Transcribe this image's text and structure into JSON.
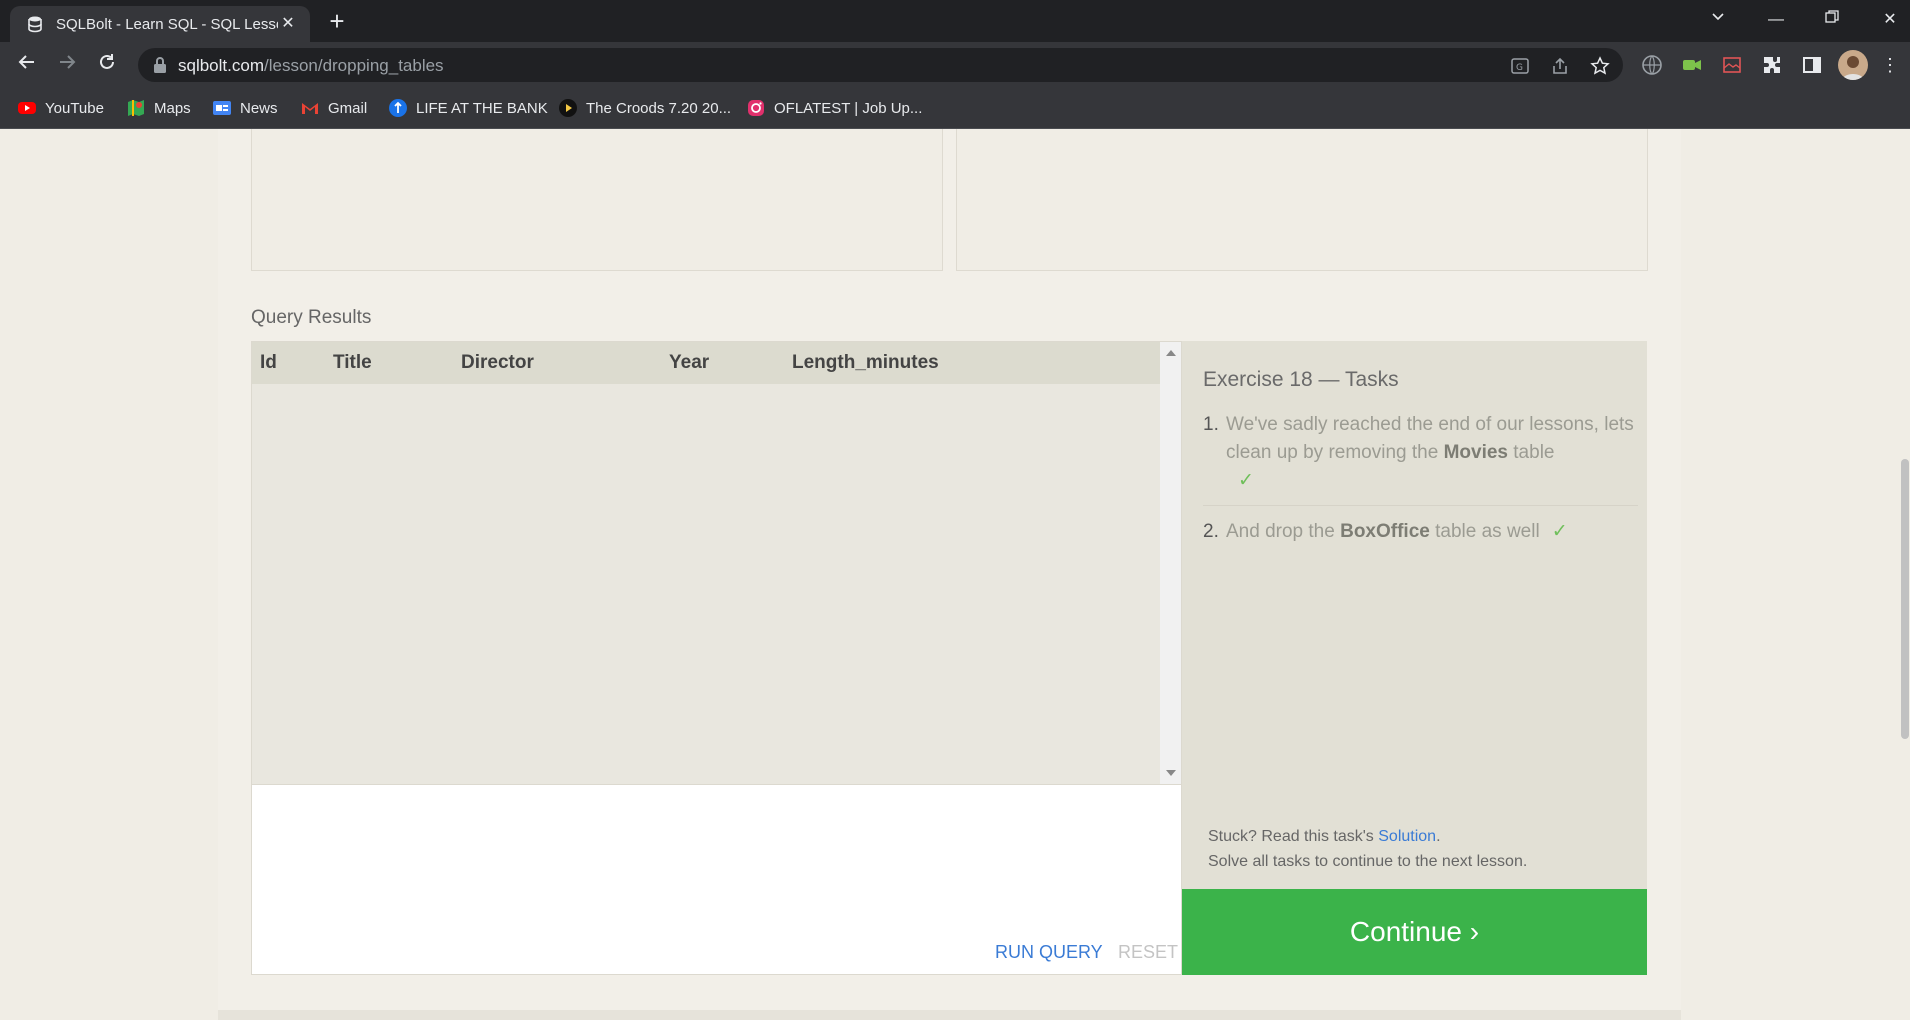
{
  "browser": {
    "tab_title": "SQLBolt - Learn SQL - SQL Lesson",
    "url_host": "sqlbolt.com",
    "url_path": "/lesson/dropping_tables",
    "bookmarks": [
      {
        "label": "YouTube",
        "icon": "youtube-icon"
      },
      {
        "label": "Maps",
        "icon": "maps-icon"
      },
      {
        "label": "News",
        "icon": "news-icon"
      },
      {
        "label": "Gmail",
        "icon": "gmail-icon"
      },
      {
        "label": "LIFE AT THE BANK",
        "icon": "bank-icon"
      },
      {
        "label": "The Croods 7.20 20...",
        "icon": "play-icon"
      },
      {
        "label": "OFLATEST | Job Up...",
        "icon": "instagram-icon"
      }
    ]
  },
  "query_results": {
    "label": "Query Results",
    "columns": [
      "Id",
      "Title",
      "Director",
      "Year",
      "Length_minutes"
    ]
  },
  "editor": {
    "run_label": "RUN QUERY",
    "reset_label": "RESET"
  },
  "tasks": {
    "title": "Exercise 18 — Tasks",
    "items": [
      {
        "num": "1.",
        "pre": "We've sadly reached the end of our lessons, lets clean up by removing the ",
        "bold": "Movies",
        "post": " table",
        "check": "✓"
      },
      {
        "num": "2.",
        "pre": "And drop the ",
        "bold": "BoxOffice",
        "post": " table as well",
        "check": "✓"
      }
    ],
    "stuck_pre": "Stuck? Read this task's ",
    "solution_link": "Solution",
    "stuck_post": ".",
    "solve_all": "Solve all tasks to continue to the next lesson."
  },
  "continue_label": "Continue ›",
  "colors": {
    "accent_green": "#3bb34a",
    "link_blue": "#3a7bd5"
  }
}
